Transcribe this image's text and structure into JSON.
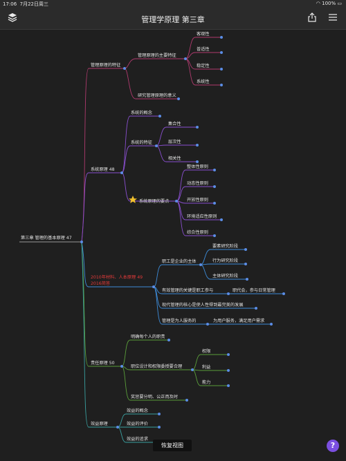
{
  "status": {
    "time": "17:06",
    "date": "7月22日周三",
    "battery": "100%"
  },
  "nav": {
    "title": "管理学原理 第三章"
  },
  "root": "第三章 管理的基本原理 47",
  "b1": {
    "label": "管理原理的特征",
    "sub1": "管理原理的主要特征",
    "items": [
      "客观性",
      "普适性",
      "稳定性",
      "系统性"
    ],
    "sub2": "研究管理原理的意义"
  },
  "b2": {
    "label": "系统原理 48",
    "sub1": "系统的概念",
    "sub2": "系统的特征",
    "features": [
      "集合性",
      "层次性",
      "相关性"
    ],
    "sub3": "系统原理的要点",
    "points": [
      "整体性原则",
      "动态性原则",
      "开放性原则",
      "环境适应性原则",
      "综合性原则"
    ]
  },
  "b3": {
    "label_l1": "2010年材料、人本原理 49",
    "label_l2": "2016简答",
    "sub1": "职工是企业的主体",
    "stages": [
      "要素研究阶段",
      "行为研究阶段",
      "主体研究阶段"
    ],
    "sub2": "有效管理的关键是职工参与",
    "sub2_note": "职代会，参与日常管理",
    "sub3": "现代管理的核心是使人性得到最完美的发展",
    "sub4": "管理是为人服务的",
    "sub4_note": "为用户服务，满足用户需求"
  },
  "b4": {
    "label": "责任原理 50",
    "sub1": "明确每个人的职责",
    "sub2": "职位设计和权限委授要合理",
    "items": [
      "权限",
      "利益",
      "能力"
    ],
    "sub3": "奖惩要分明、公正而及时"
  },
  "b5": {
    "label": "效益原理",
    "items": [
      "效益的概念",
      "效益的评价",
      "效益的追求"
    ]
  },
  "restore_label": "恢复视图",
  "help_label": "?",
  "colors": {
    "line_red": "#b03a6e",
    "line_purple": "#8a4fd0",
    "line_blue": "#3d8bd8",
    "line_green": "#5a9e3a",
    "node_dot": "#5b8de6"
  }
}
